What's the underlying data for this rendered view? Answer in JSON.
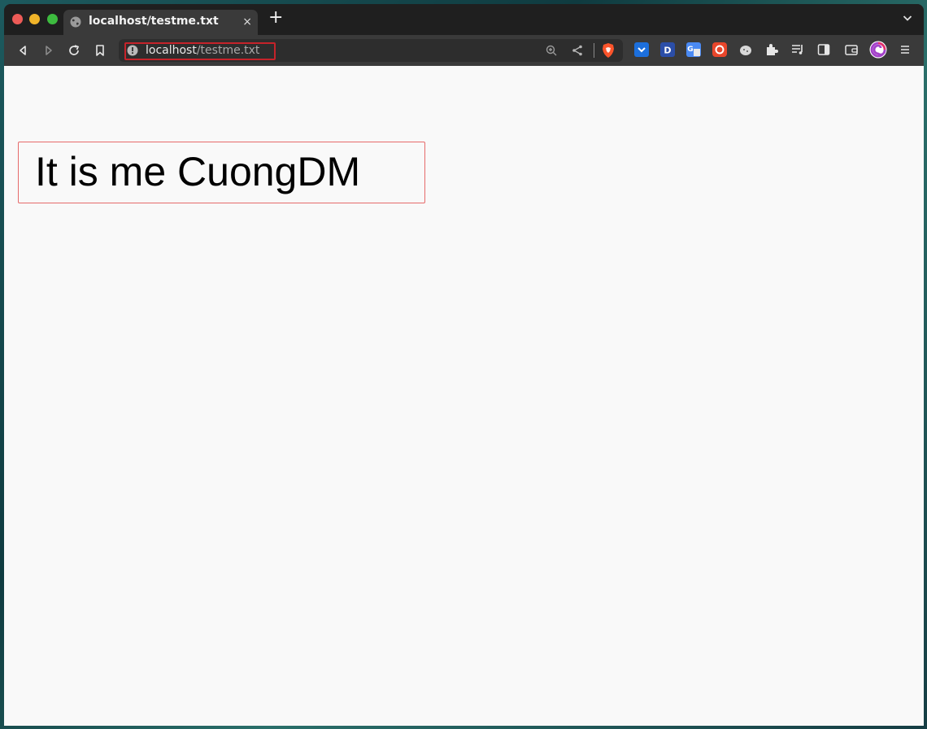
{
  "browser": {
    "tab": {
      "title": "localhost/testme.txt",
      "close_glyph": "×"
    },
    "new_tab_glyph": "+",
    "address_bar": {
      "host": "localhost",
      "path": "/testme.txt"
    },
    "icons": [
      "back-icon",
      "forward-icon",
      "reload-icon",
      "bookmark-icon",
      "site-info-icon",
      "zoom-icon",
      "share-icon",
      "brave-shields-icon",
      "extension-icon",
      "puzzle-icon",
      "playlist-icon",
      "sidebar-icon",
      "wallet-icon",
      "profile-icon",
      "menu-icon"
    ]
  },
  "page": {
    "text": "It is me CuongDM"
  },
  "colors": {
    "highlight_outline": "#c5232a",
    "text_box_outline": "#e66a6a"
  }
}
